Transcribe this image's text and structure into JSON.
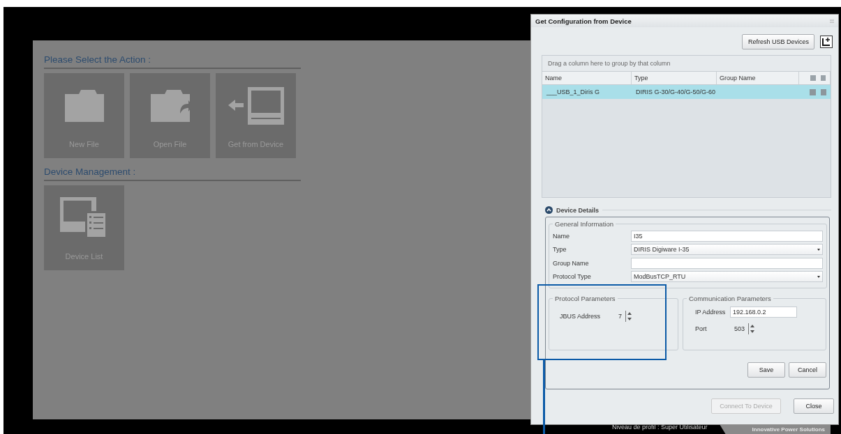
{
  "home": {
    "sections": [
      {
        "title": "Please Select the Action :",
        "tiles": [
          {
            "label": "New File",
            "kind": "new"
          },
          {
            "label": "Open File",
            "kind": "open"
          },
          {
            "label": "Get from Device",
            "kind": "device"
          }
        ]
      },
      {
        "title": "Device Management :",
        "tiles": [
          {
            "label": "Device List",
            "kind": "list"
          }
        ]
      }
    ]
  },
  "dialog": {
    "title": "Get Configuration from Device",
    "refresh_button": "Refresh USB Devices",
    "grid": {
      "group_hint": "Drag a column here to group by that column",
      "columns": [
        "Name",
        "Type",
        "Group Name"
      ],
      "rows": [
        {
          "name": "___USB_1_Diris G",
          "type": "DIRIS G-30/G-40/G-50/G-60",
          "selected": true
        }
      ]
    },
    "details": {
      "title": "Device Details",
      "expanded": true,
      "general": {
        "title": "General Information",
        "fields": [
          {
            "label": "Name",
            "kind": "text",
            "value": "I35"
          },
          {
            "label": "Type",
            "kind": "dropdown",
            "value": "DIRIS Digiware I-35"
          },
          {
            "label": "Group Name",
            "kind": "text"
          },
          {
            "label": "Protocol Type",
            "kind": "dropdown",
            "value": "ModBusTCP_RTU"
          }
        ]
      },
      "protocol": {
        "title": "Protocol Parameters",
        "fields": [
          {
            "label": "JBUS Address",
            "kind": "spinner",
            "value": "7"
          }
        ]
      },
      "communication": {
        "title": "Communication Parameters",
        "fields": [
          {
            "label": "IP Address",
            "kind": "text",
            "value": "192.168.0.2"
          },
          {
            "label": "Port",
            "kind": "spinner",
            "value": "503"
          }
        ]
      },
      "buttons": [
        "Save",
        "Cancel"
      ]
    },
    "footer_buttons": [
      {
        "label": "Connect To Device",
        "disabled": true
      },
      {
        "label": "Close",
        "disabled": false
      }
    ]
  },
  "status_bar": {
    "profile": "Niveau de profil : Super Utilisateur",
    "tagline": "Innovative Power Solutions"
  }
}
